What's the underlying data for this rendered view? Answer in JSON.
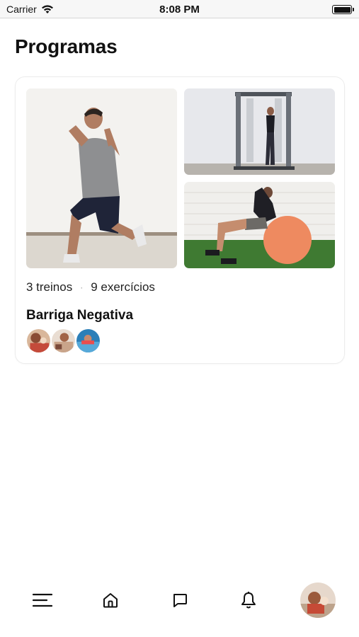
{
  "status_bar": {
    "carrier": "Carrier",
    "time": "8:08 PM",
    "icons": [
      "wifi-icon",
      "battery-icon"
    ]
  },
  "page": {
    "title": "Programas"
  },
  "program": {
    "workouts": "3 treinos",
    "separator": "·",
    "exercises": "9 exercícios",
    "name": "Barriga Negativa",
    "images": [
      "man-lunge-photo",
      "woman-cable-machine-photo",
      "woman-exercise-ball-photo"
    ],
    "participant_count": 3
  },
  "tab_bar": {
    "items": [
      "menu-icon",
      "home-icon",
      "chat-icon",
      "bell-icon",
      "profile-avatar"
    ]
  }
}
